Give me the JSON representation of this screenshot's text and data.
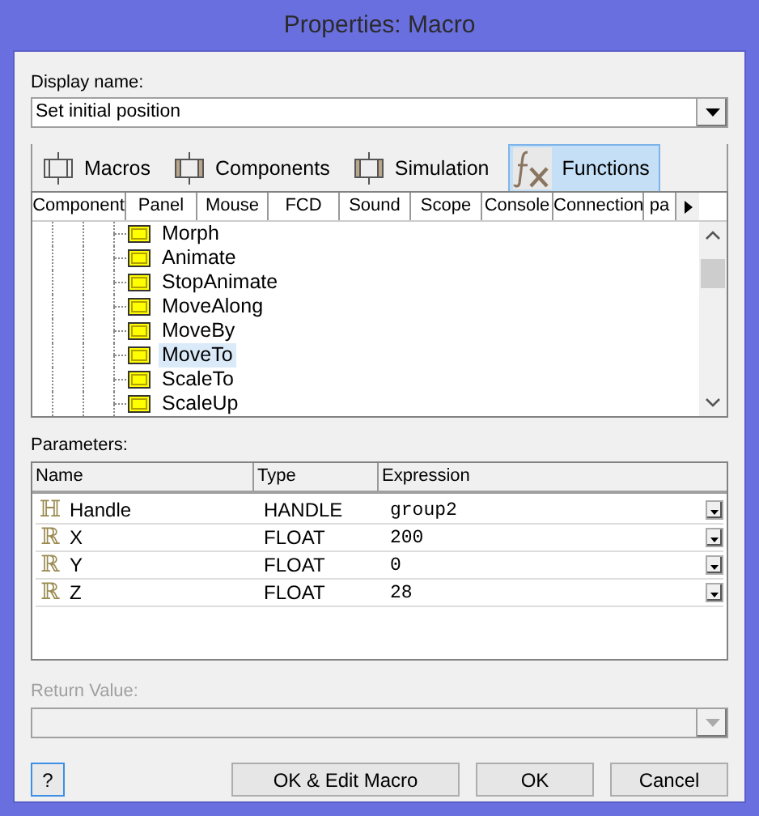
{
  "window": {
    "title": "Properties: Macro"
  },
  "display_name": {
    "label": "Display name:",
    "value": "Set initial position"
  },
  "tabs": [
    {
      "label": "Macros",
      "kind": "plain",
      "selected": false
    },
    {
      "label": "Components",
      "kind": "hatched",
      "selected": false
    },
    {
      "label": "Simulation",
      "kind": "hatched",
      "selected": false
    },
    {
      "label": "Functions",
      "kind": "fx",
      "selected": true
    }
  ],
  "category_columns": [
    "Component",
    "Panel",
    "Mouse",
    "FCD",
    "Sound",
    "Scope",
    "Console",
    "Connection",
    "pa"
  ],
  "functions": [
    {
      "label": "Morph",
      "selected": false
    },
    {
      "label": "Animate",
      "selected": false
    },
    {
      "label": "StopAnimate",
      "selected": false
    },
    {
      "label": "MoveAlong",
      "selected": false
    },
    {
      "label": "MoveBy",
      "selected": false
    },
    {
      "label": "MoveTo",
      "selected": true
    },
    {
      "label": "ScaleTo",
      "selected": false
    },
    {
      "label": "ScaleUp",
      "selected": false
    }
  ],
  "parameters": {
    "label": "Parameters:",
    "columns": [
      "Name",
      "Type",
      "Expression"
    ],
    "rows": [
      {
        "icon": "ℍ",
        "name": "Handle",
        "type": "HANDLE",
        "expression": "group2"
      },
      {
        "icon": "ℝ",
        "name": "X",
        "type": "FLOAT",
        "expression": "200"
      },
      {
        "icon": "ℝ",
        "name": "Y",
        "type": "FLOAT",
        "expression": "0"
      },
      {
        "icon": "ℝ",
        "name": "Z",
        "type": "FLOAT",
        "expression": "28"
      }
    ]
  },
  "return_value": {
    "label": "Return Value:",
    "disabled": true
  },
  "buttons": [
    {
      "label": "?",
      "kind": "help"
    },
    {
      "label": "OK & Edit Macro",
      "kind": "action"
    },
    {
      "label": "OK",
      "kind": "action"
    },
    {
      "label": "Cancel",
      "kind": "action"
    }
  ]
}
